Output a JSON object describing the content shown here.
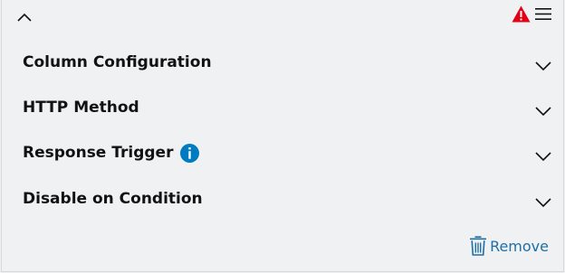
{
  "header": {
    "collapse_icon": "chevron-up-icon",
    "warning_icon": "warning-triangle-icon",
    "menu_icon": "hamburger-menu-icon"
  },
  "sections": [
    {
      "label": "Column Configuration",
      "icon": "chevron-down-icon"
    },
    {
      "label": "HTTP Method",
      "icon": "chevron-down-icon"
    },
    {
      "label": "Response Trigger",
      "info_icon": "info-icon",
      "icon": "chevron-down-icon"
    },
    {
      "label": "Disable on Condition",
      "icon": "chevron-down-icon"
    }
  ],
  "footer": {
    "remove_label": "Remove",
    "remove_icon": "trash-icon"
  },
  "colors": {
    "background": "#eff1f2",
    "warning": "#e20015",
    "info": "#007bc0",
    "link": "#1f6fa6",
    "text": "#111214"
  }
}
